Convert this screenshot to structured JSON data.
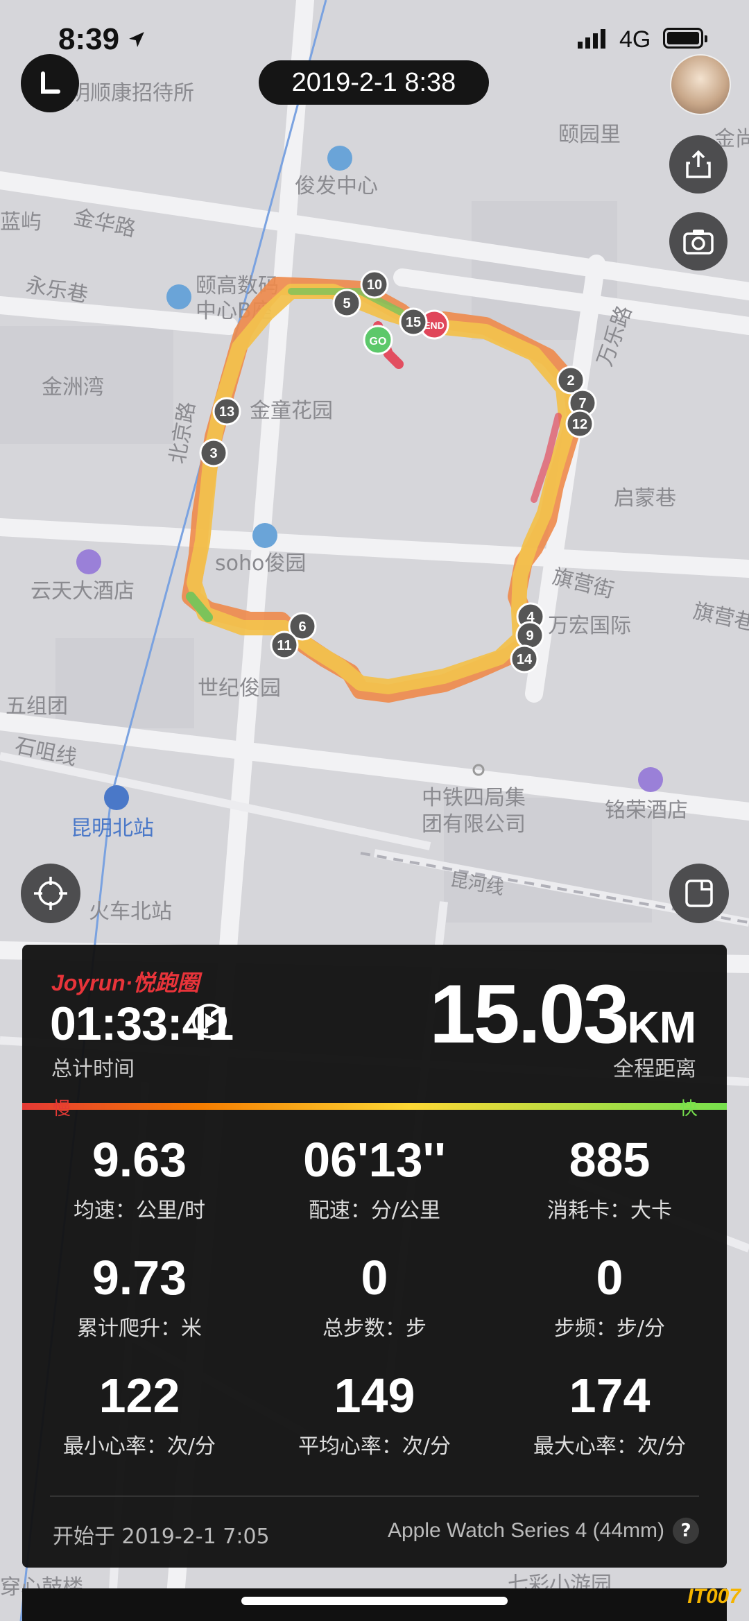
{
  "status_bar": {
    "time": "8:39",
    "network": "4G"
  },
  "header": {
    "date_time": "2019-2-1 8:38"
  },
  "map": {
    "labels": [
      "明顺康招待所",
      "颐园里",
      "俊发中心",
      "金华路",
      "蓝屿",
      "颐高数码",
      "中心B座",
      "永乐巷",
      "金洲湾",
      "金童花园",
      "万乐路",
      "北京路",
      "启蒙巷",
      "soho俊园",
      "云天大酒店",
      "旗营街",
      "万宏国际",
      "旗营巷",
      "世纪俊园",
      "五组团",
      "石咀线",
      "中铁四局集",
      "团有限公司",
      "铭荣酒店",
      "昆明北站",
      "火车北站",
      "昆河线",
      "穿心鼓楼",
      "七彩小游园",
      "金尚"
    ],
    "markers": [
      "GO",
      "END",
      "2",
      "3",
      "4",
      "5",
      "6",
      "7",
      "9",
      "10",
      "11",
      "12",
      "13",
      "14",
      "15"
    ]
  },
  "panel": {
    "brand": "Joyrun·悦跑圈",
    "duration": "01:33:41",
    "duration_label": "总计时间",
    "distance": "15.03",
    "distance_unit": "KM",
    "distance_label": "全程距离",
    "slow_label": "慢",
    "fast_label": "快",
    "stats": [
      {
        "value": "9.63",
        "label": "均速：公里/时"
      },
      {
        "value": "06'13''",
        "label": "配速：分/公里"
      },
      {
        "value": "885",
        "label": "消耗卡：大卡"
      },
      {
        "value": "9.73",
        "label": "累计爬升：米"
      },
      {
        "value": "0",
        "label": "总步数：步"
      },
      {
        "value": "0",
        "label": "步频：步/分"
      },
      {
        "value": "122",
        "label": "最小心率：次/分"
      },
      {
        "value": "149",
        "label": "平均心率：次/分"
      },
      {
        "value": "174",
        "label": "最大心率：次/分"
      }
    ],
    "start_text": "开始于 2019-2-1 7:05",
    "device": "Apple Watch Series 4 (44mm)",
    "help": "?"
  },
  "watermark": "IT007",
  "colors": {
    "accent_red": "#e8343a",
    "route_yellow": "#f2c14e",
    "route_orange": "#ee8a4a",
    "route_green": "#7cc35a"
  },
  "icons": [
    "location-arrow-icon",
    "signal-icon",
    "battery-icon",
    "back-icon",
    "share-icon",
    "camera-icon",
    "locate-icon",
    "layers-icon",
    "play-icon",
    "help-icon"
  ]
}
